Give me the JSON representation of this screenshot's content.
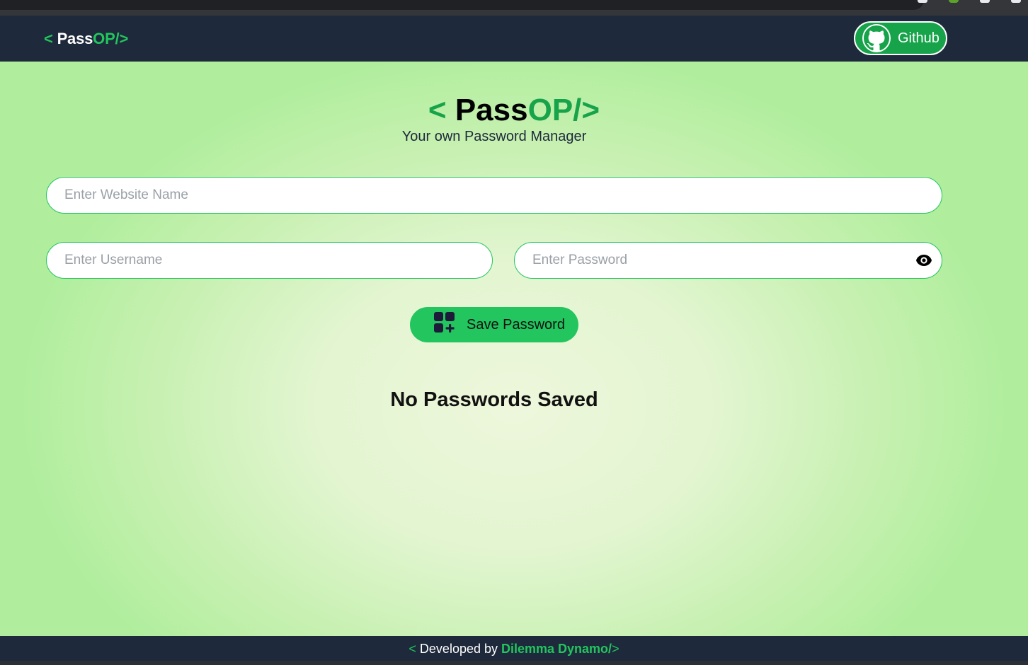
{
  "navbar": {
    "logo": {
      "open": "< ",
      "pass": "Pass",
      "op": "OP/",
      "close": ">"
    },
    "github_label": "Github"
  },
  "hero": {
    "title": {
      "open": "< ",
      "pass": "Pass",
      "op": "OP/",
      "close": ">"
    },
    "subtitle": "Your own Password Manager"
  },
  "form": {
    "website_placeholder": "Enter Website Name",
    "username_placeholder": "Enter Username",
    "password_placeholder": "Enter Password",
    "save_label": "Save Password"
  },
  "list": {
    "empty_message": "No Passwords Saved"
  },
  "footer": {
    "open": "< ",
    "developed_by": "Developed by ",
    "developer": "Dilemma Dynamo/",
    "close": ">"
  },
  "icons": [
    "github-icon",
    "eye-icon",
    "add-grid-icon"
  ],
  "colors": {
    "nav_bg": "#1e293b",
    "accent": "#22c55e",
    "accent_dark": "#16a34a"
  }
}
